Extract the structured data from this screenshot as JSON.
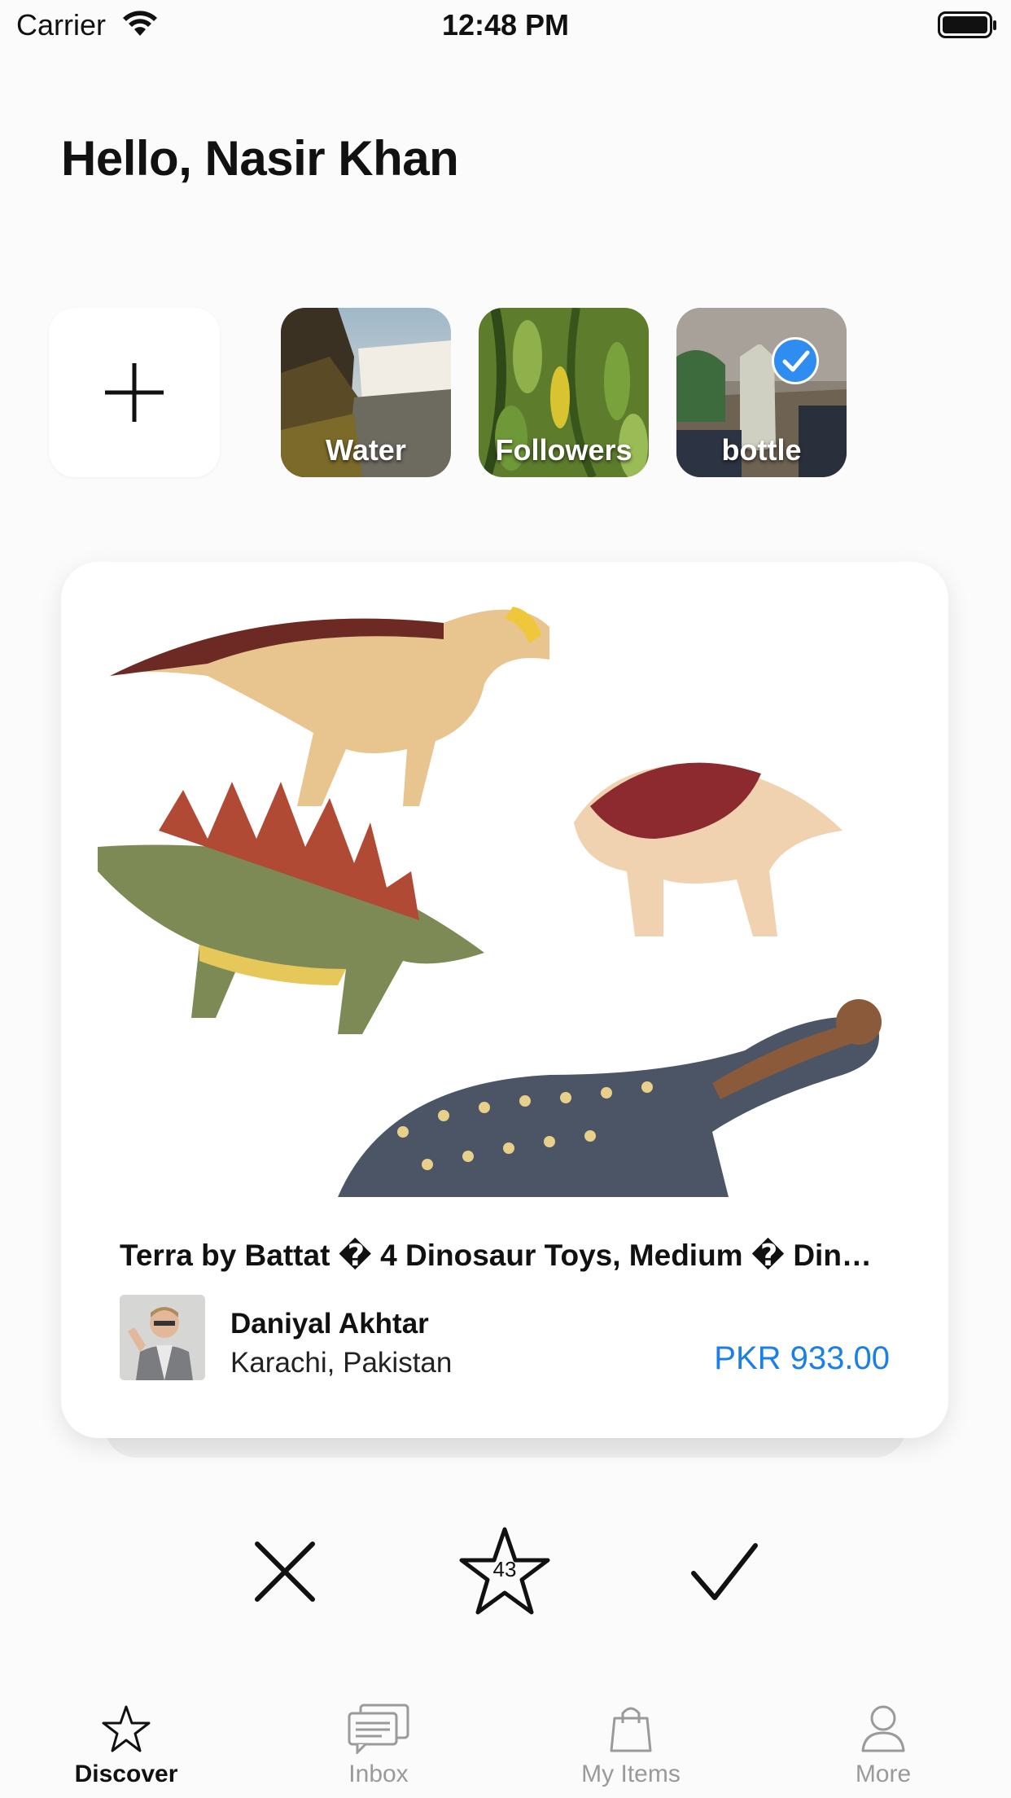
{
  "status_bar": {
    "carrier": "Carrier",
    "time": "12:48 PM"
  },
  "greeting": "Hello, Nasir Khan",
  "collections": [
    {
      "label": "Water",
      "selected": false
    },
    {
      "label": "Followers",
      "selected": false
    },
    {
      "label": "bottle",
      "selected": true
    }
  ],
  "product": {
    "title": "Terra by Battat � 4 Dinosaur Toys, Medium � Din…",
    "seller_name": "Daniyal Akhtar",
    "seller_location": "Karachi, Pakistan",
    "price": "PKR 933.00"
  },
  "actions": {
    "favorites_count": "43"
  },
  "tabs": [
    {
      "label": "Discover",
      "icon": "star-icon",
      "active": true
    },
    {
      "label": "Inbox",
      "icon": "chat-icon",
      "active": false
    },
    {
      "label": "My Items",
      "icon": "shopping-bag-icon",
      "active": false
    },
    {
      "label": "More",
      "icon": "person-icon",
      "active": false
    }
  ],
  "colors": {
    "accent": "#1a7fe6",
    "check_badge": "#2f8cf0"
  }
}
